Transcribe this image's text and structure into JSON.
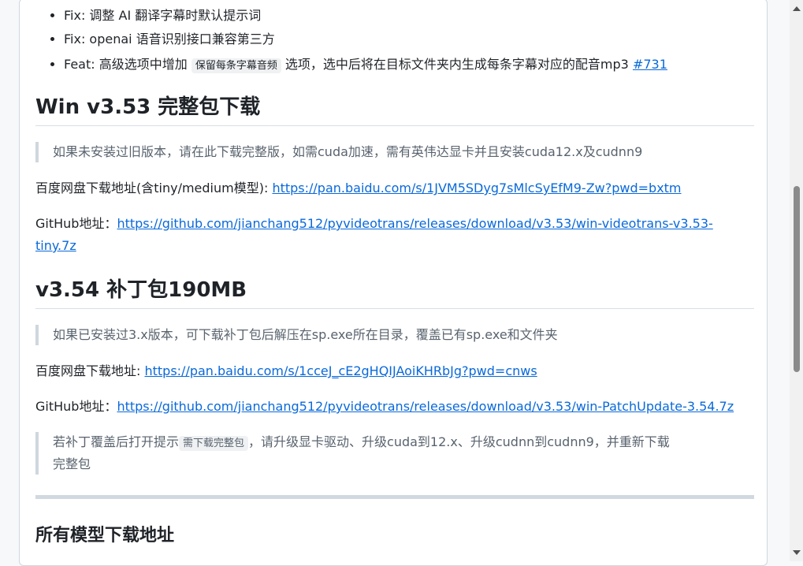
{
  "notes": [
    {
      "text": "Fix: 调整 AI 翻译字幕时默认提示词"
    },
    {
      "text": "Fix: openai 语音识别接口兼容第三方"
    },
    {
      "pre": "Feat: 高级选项中增加 ",
      "code": "保留每条字幕音频",
      "post": " 选项，选中后将在目标文件夹内生成每条字幕对应的配音mp3 ",
      "link": "#731"
    }
  ],
  "sec1": {
    "title": "Win v3.53 完整包下载",
    "quote": "如果未安装过旧版本，请在此下载完整版，如需cuda加速，需有英伟达显卡并且安装cuda12.x及cudnn9",
    "baidu_label": "百度网盘下载地址(含tiny/medium模型): ",
    "baidu_link": "https://pan.baidu.com/s/1JVM5SDyg7sMlcSyEfM9-Zw?pwd=bxtm",
    "github_label": "GitHub地址：",
    "github_link_1": "https://github.com/jianchang512/pyvideotrans/releases/download/v3.53/win-videotrans-v3.53-",
    "github_link_2": "tiny.7z"
  },
  "sec2": {
    "title": "v3.54 补丁包190MB",
    "quote": "如果已安装过3.x版本，可下载补丁包后解压在sp.exe所在目录，覆盖已有sp.exe和文件夹",
    "baidu_label": "百度网盘下载地址: ",
    "baidu_link": "https://pan.baidu.com/s/1cceJ_cE2gHQIJAoiKHRbJg?pwd=cnws",
    "github_label": "GitHub地址：",
    "github_link": "https://github.com/jianchang512/pyvideotrans/releases/download/v3.53/win-PatchUpdate-3.54.7z",
    "quote2_pre": "若补丁覆盖后打开提示",
    "quote2_code": "需下载完整包",
    "quote2_post": "，请升级显卡驱动、升级cuda到12.x、升级cudnn到cudnn9，并重新下载",
    "quote2_line2": "完整包"
  },
  "sec3": {
    "title": "所有模型下载地址"
  }
}
